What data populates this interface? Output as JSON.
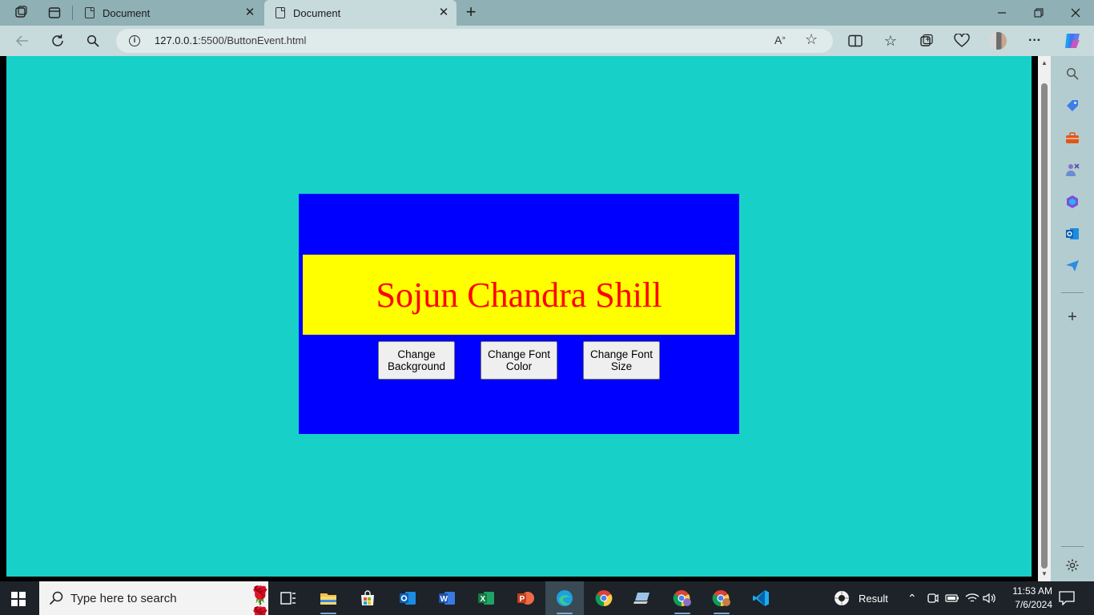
{
  "browser": {
    "tabs": [
      {
        "title": "Document",
        "active": false
      },
      {
        "title": "Document",
        "active": true
      }
    ],
    "url_host": "127.0.0.1",
    "url_path": ":5500/ButtonEvent.html"
  },
  "page": {
    "background": "#17d1c8",
    "card_background": "#0000ff",
    "banner_background": "#ffff00",
    "heading": "Sojun Chandra Shill",
    "heading_color": "#ff0000",
    "buttons": [
      {
        "label": "Change Background"
      },
      {
        "label": "Change Font Color"
      },
      {
        "label": "Change Font Size"
      }
    ]
  },
  "taskbar": {
    "search_placeholder": "Type here to search",
    "widget_label": "Result",
    "time": "11:53 AM",
    "date": "7/6/2024"
  }
}
